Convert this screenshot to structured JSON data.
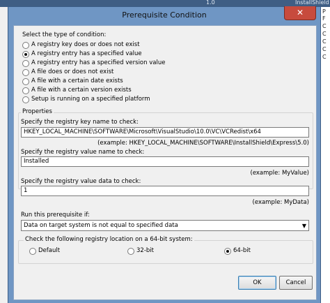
{
  "background": {
    "top_text": "1.0",
    "top_right_text": "InstallShield",
    "right_letters": [
      "P",
      "F",
      "C",
      "C",
      "C",
      "C",
      "C"
    ]
  },
  "dialog": {
    "title": "Prerequisite Condition",
    "close_glyph": "✕",
    "condition_type_label": "Select the type of condition:",
    "conditions": [
      {
        "label": "A registry key does or does not exist",
        "selected": false
      },
      {
        "label": "A registry entry has a specified value",
        "selected": true
      },
      {
        "label": "A registry entry has a specified version value",
        "selected": false
      },
      {
        "label": "A file does or does not exist",
        "selected": false
      },
      {
        "label": "A file with a certain date exists",
        "selected": false
      },
      {
        "label": "A file with a certain version exists",
        "selected": false
      },
      {
        "label": "Setup is running on a specified platform",
        "selected": false
      }
    ],
    "properties": {
      "legend": "Properties",
      "key_label": "Specify the registry key name to check:",
      "key_value": "HKEY_LOCAL_MACHINE\\SOFTWARE\\Microsoft\\VisualStudio\\10.0\\VC\\VCRedist\\x64",
      "key_example": "(example: HKEY_LOCAL_MACHINE\\SOFTWARE\\InstallShield\\Express\\5.0)",
      "value_name_label": "Specify the registry value name to check:",
      "value_name": "Installed",
      "value_name_example": "(example: MyValue)",
      "value_data_label": "Specify the registry value data to check:",
      "value_data": "1",
      "value_data_example": "(example: MyData)"
    },
    "run_if_label": "Run this prerequisite if:",
    "run_if_value": "Data on target system is not equal to specified data",
    "location": {
      "legend": "Check the following registry location on a 64-bit system:",
      "options": [
        {
          "label": "Default",
          "selected": false
        },
        {
          "label": "32-bit",
          "selected": false
        },
        {
          "label": "64-bit",
          "selected": true
        }
      ]
    },
    "ok_label": "OK",
    "cancel_label": "Cancel"
  },
  "colors": {
    "frame": "#6f96c4",
    "close_button": "#c74b3d",
    "client_bg": "#f0f0f0"
  }
}
